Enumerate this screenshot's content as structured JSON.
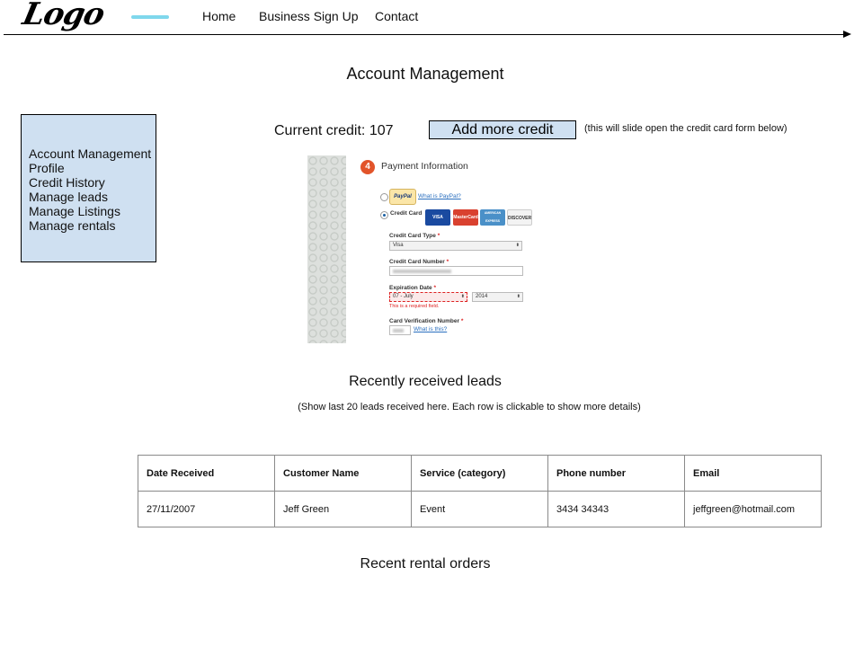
{
  "header": {
    "logo_text": "Logo",
    "nav": [
      "Home",
      "Business Sign Up",
      "Contact"
    ]
  },
  "page_title": "Account Management",
  "sidebar": {
    "items": [
      "Account Management",
      "Profile",
      "Credit History",
      "Manage leads",
      "Manage Listings",
      "Manage rentals"
    ]
  },
  "credit": {
    "label": "Current credit: 107",
    "add_button": "Add more credit",
    "note": "(this will slide open the credit card form below)"
  },
  "payment_form": {
    "step_number": "4",
    "title": "Payment Information",
    "paypal_badge": "PayPal",
    "paypal_link": "What is PayPal?",
    "credit_card_label": "Credit Card",
    "card_logos": [
      "VISA",
      "MasterCard",
      "AMERICAN EXPRESS",
      "DISCOVER"
    ],
    "card_type_label": "Credit Card Type",
    "card_type_value": "Visa",
    "card_number_label": "Credit Card Number",
    "expiration_label": "Expiration Date",
    "expiration_month": "07 - July",
    "expiration_year": "2014",
    "error_text": "This is a required field.",
    "cvv_label": "Card Verification Number",
    "cvv_link": "What is this?",
    "required_mark": "*"
  },
  "leads": {
    "title": "Recently received leads",
    "note": "(Show last 20 leads received here. Each row is clickable to show more details)",
    "columns": [
      "Date Received",
      "Customer Name",
      "Service (category)",
      "Phone number",
      "Email"
    ],
    "rows": [
      [
        "27/11/2007",
        "Jeff Green",
        "Event",
        "3434 34343",
        "jeffgreen@hotmail.com"
      ]
    ]
  },
  "rentals": {
    "title": "Recent rental orders"
  },
  "colors": {
    "panel_fill": "#cfe0f1",
    "step_badge": "#e2542a",
    "link": "#2a6fbf",
    "error": "#d22222"
  }
}
